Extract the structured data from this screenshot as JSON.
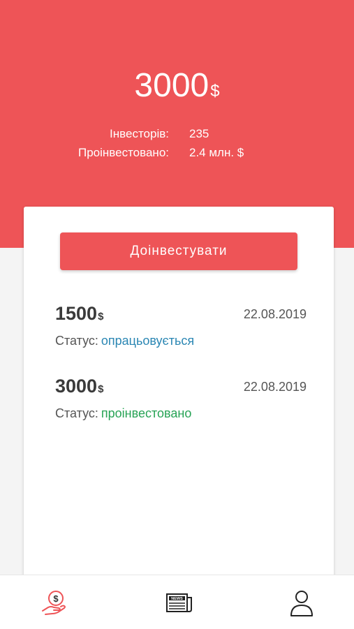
{
  "header": {
    "balance": "3000",
    "balance_currency": "$",
    "stats": [
      {
        "label": "Інвесторів:",
        "value": "235"
      },
      {
        "label": "Проінвестовано:",
        "value": "2.4 млн. $"
      }
    ]
  },
  "card": {
    "button_label": "Доінвестувати",
    "investments": [
      {
        "amount": "1500",
        "currency": "$",
        "date": "22.08.2019",
        "status_label": "Статус:",
        "status_value": "опрацьовується"
      },
      {
        "amount": "3000",
        "currency": "$",
        "date": "22.08.2019",
        "status_label": "Статус:",
        "status_value": "проінвестовано"
      }
    ]
  },
  "colors": {
    "accent": "#ee5457",
    "status_processing": "#2a86b3",
    "status_invested": "#27a355"
  },
  "nav": {
    "items": [
      {
        "icon": "money-hand-icon",
        "active": true
      },
      {
        "icon": "news-icon",
        "active": false
      },
      {
        "icon": "user-icon",
        "active": false
      }
    ]
  }
}
